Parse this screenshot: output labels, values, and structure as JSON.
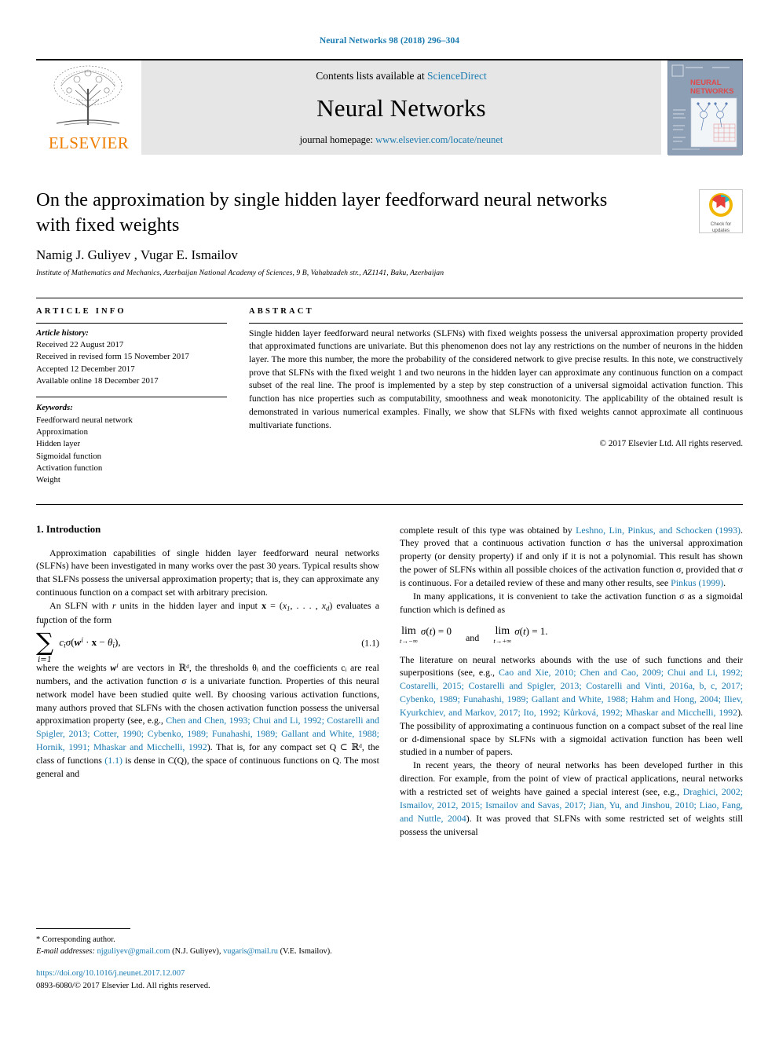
{
  "running_head": "Neural Networks 98 (2018) 296–304",
  "masthead": {
    "publisher": "ELSEVIER",
    "contents_prefix": "Contents lists available at ",
    "contents_link": "ScienceDirect",
    "journal_title": "Neural Networks",
    "homepage_prefix": "journal homepage: ",
    "homepage_url": "www.elsevier.com/locate/neunet",
    "cover_title_line1": "NEURAL",
    "cover_title_line2": "NETWORKS"
  },
  "article": {
    "title": "On the approximation by single hidden layer feedforward neural networks with fixed weights",
    "authors": "Namig J. Guliyev , Vugar E. Ismailov",
    "author_star": "*",
    "affiliation": "Institute of Mathematics and Mechanics, Azerbaijan National Academy of Sciences, 9 B, Vahabzadeh str., AZ1141, Baku, Azerbaijan",
    "crossmark_line1": "Check for",
    "crossmark_line2": "updates"
  },
  "info": {
    "heading": "ARTICLE INFO",
    "history_label": "Article history:",
    "history": [
      "Received 22 August 2017",
      "Received in revised form 15 November 2017",
      "Accepted 12 December 2017",
      "Available online 18 December 2017"
    ],
    "keywords_label": "Keywords:",
    "keywords": [
      "Feedforward neural network",
      "Approximation",
      "Hidden layer",
      "Sigmoidal function",
      "Activation function",
      "Weight"
    ]
  },
  "abstract": {
    "heading": "ABSTRACT",
    "text": "Single hidden layer feedforward neural networks (SLFNs) with fixed weights possess the universal approximation property provided that approximated functions are univariate. But this phenomenon does not lay any restrictions on the number of neurons in the hidden layer. The more this number, the more the probability of the considered network to give precise results. In this note, we constructively prove that SLFNs with the fixed weight 1 and two neurons in the hidden layer can approximate any continuous function on a compact subset of the real line. The proof is implemented by a step by step construction of a universal sigmoidal activation function. This function has nice properties such as computability, smoothness and weak monotonicity. The applicability of the obtained result is demonstrated in various numerical examples. Finally, we show that SLFNs with fixed weights cannot approximate all continuous multivariate functions.",
    "copyright": "© 2017 Elsevier Ltd. All rights reserved."
  },
  "body": {
    "section_title": "1. Introduction",
    "left_p1": "Approximation capabilities of single hidden layer feedforward neural networks (SLFNs) have been investigated in many works over the past 30 years. Typical results show that SLFNs possess the universal approximation property; that is, they can approximate any continuous function on a compact set with arbitrary precision.",
    "left_p2_a": "An SLFN with ",
    "left_p2_r": "r",
    "left_p2_b": " units in the hidden layer and input ",
    "left_p2_x": "x",
    "left_p2_c": " = (",
    "left_p2_coords": "x₁, . . . , x_d",
    "left_p2_d": ") evaluates a function of the form",
    "equation_number": "(1.1)",
    "eq_sum_top": "r",
    "eq_sum_bottom": "i=1",
    "eq_body": "c_i σ(w^i · x − θ_i),",
    "left_p3_pre": "where the weights ",
    "left_p3_text": "are vectors in ℝᵈ, the thresholds θᵢ and the coefficients cᵢ are real numbers, and the activation function σ is a univariate function. Properties of this neural network model have been studied quite well. By choosing various activation functions, many authors proved that SLFNs with the chosen activation function possess the universal approximation property (see, e.g., ",
    "left_p3_cites": "Chen and Chen, 1993; Chui and Li, 1992; Costarelli and Spigler, 2013; Cotter, 1990; Cybenko, 1989; Funahashi, 1989; Gallant and White, 1988; Hornik, 1991; Mhaskar and Micchelli, 1992",
    "left_p3_post": "). That is, for any compact set Q ⊂ ℝᵈ, the class of functions ",
    "left_p3_eqref": "(1.1)",
    "left_p3_tail": " is dense in C(Q), the space of continuous functions on Q. The most general and",
    "right_p1_pre": "complete result of this type was obtained by ",
    "right_p1_cite": "Leshno, Lin, Pinkus, and Schocken",
    "right_p1_year": "(1993)",
    "right_p1_post": ". They proved that a continuous activation function σ has the universal approximation property (or density property) if and only if it is not a polynomial. This result has shown the power of SLFNs within all possible choices of the activation function σ, provided that σ is continuous. For a detailed review of these and many other results, see ",
    "right_p1_cite2": "Pinkus",
    "right_p1_year2": "(1999)",
    "right_p1_end": ".",
    "right_p2": "In many applications, it is convenient to take the activation function σ as a sigmoidal function which is defined as",
    "limit_left_op": "lim",
    "limit_left_under": "t→−∞",
    "limit_left_expr": "σ(t) = 0",
    "limit_connector": "and",
    "limit_right_op": "lim",
    "limit_right_under": "t→+∞",
    "limit_right_expr": "σ(t) = 1.",
    "right_p3_pre": "The literature on neural networks abounds with the use of such functions and their superpositions (see, e.g., ",
    "right_p3_cites": "Cao and Xie, 2010; Chen and Cao, 2009; Chui and Li, 1992; Costarelli, 2015; Costarelli and Spigler, 2013; Costarelli and Vinti, 2016a, b, c, 2017; Cybenko, 1989; Funahashi, 1989; Gallant and White, 1988; Hahm and Hong, 2004; Iliev, Kyurkchiev, and Markov, 2017; Ito, 1992; Kůrková, 1992; Mhaskar and Micchelli, 1992",
    "right_p3_post": "). The possibility of approximating a continuous function on a compact subset of the real line or d-dimensional space by SLFNs with a sigmoidal activation function has been well studied in a number of papers.",
    "right_p4_pre": "In recent years, the theory of neural networks has been developed further in this direction. For example, from the point of view of practical applications, neural networks with a restricted set of weights have gained a special interest (see, e.g., ",
    "right_p4_cites": "Draghici, 2002; Ismailov, 2012, 2015; Ismailov and Savas, 2017; Jian, Yu, and Jinshou, 2010; Liao, Fang, and Nuttle, 2004",
    "right_p4_post": "). It was proved that SLFNs with some restricted set of weights still possess the universal"
  },
  "footer": {
    "corresponding_mark": "*",
    "corresponding_label": "Corresponding author.",
    "email_label": "E-mail addresses:",
    "email1": "njguliyev@gmail.com",
    "email1_owner": "(N.J. Guliyev),",
    "email2": "vugaris@mail.ru",
    "email2_owner": "(V.E. Ismailov).",
    "doi": "https://doi.org/10.1016/j.neunet.2017.12.007",
    "issn_line": "0893-6080/© 2017 Elsevier Ltd. All rights reserved."
  },
  "colors": {
    "link": "#1a7bb0",
    "elsevier_orange": "#ef7d00",
    "band_gray": "#e6e6e6",
    "cover_blue": "#8d9fb5"
  }
}
